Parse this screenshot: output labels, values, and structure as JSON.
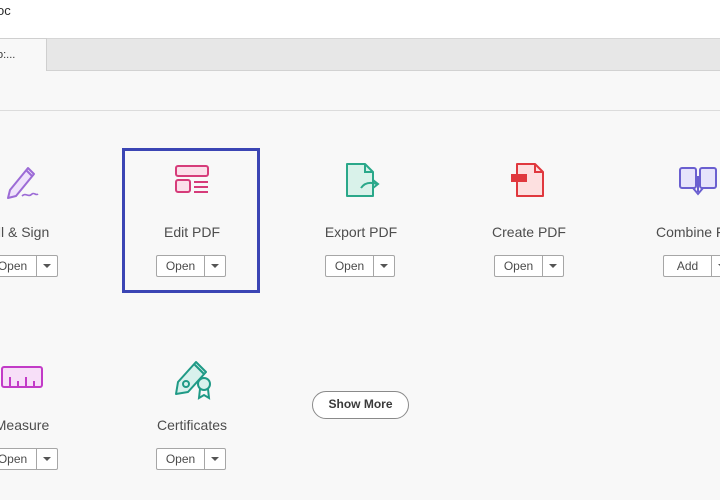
{
  "window": {
    "title": "oc"
  },
  "tabs": [
    {
      "label": "o:..."
    }
  ],
  "tools": [
    {
      "name": "Fill & Sign",
      "display": "ill & Sign",
      "button": "Open",
      "icon": "fill-sign-icon",
      "color": "#9c6bd6"
    },
    {
      "name": "Edit PDF",
      "display": "Edit PDF",
      "button": "Open",
      "icon": "edit-pdf-icon",
      "color": "#d63c7a",
      "selected": true
    },
    {
      "name": "Export PDF",
      "display": "Export PDF",
      "button": "Open",
      "icon": "export-pdf-icon",
      "color": "#2aa88a"
    },
    {
      "name": "Create PDF",
      "display": "Create PDF",
      "button": "Open",
      "icon": "create-pdf-icon",
      "color": "#e0383e"
    },
    {
      "name": "Combine Files",
      "display": "Combine F",
      "button": "Add",
      "icon": "combine-files-icon",
      "color": "#6a5fd0"
    },
    {
      "name": "Measure",
      "display": "Measure",
      "button": "Open",
      "icon": "measure-icon",
      "color": "#c23bc7"
    },
    {
      "name": "Certificates",
      "display": "Certificates",
      "button": "Open",
      "icon": "certificates-icon",
      "color": "#1f9a86"
    }
  ],
  "show_more_label": "Show More",
  "colors": {
    "selection_border": "#3b45b4",
    "background": "#f8f8f8"
  }
}
